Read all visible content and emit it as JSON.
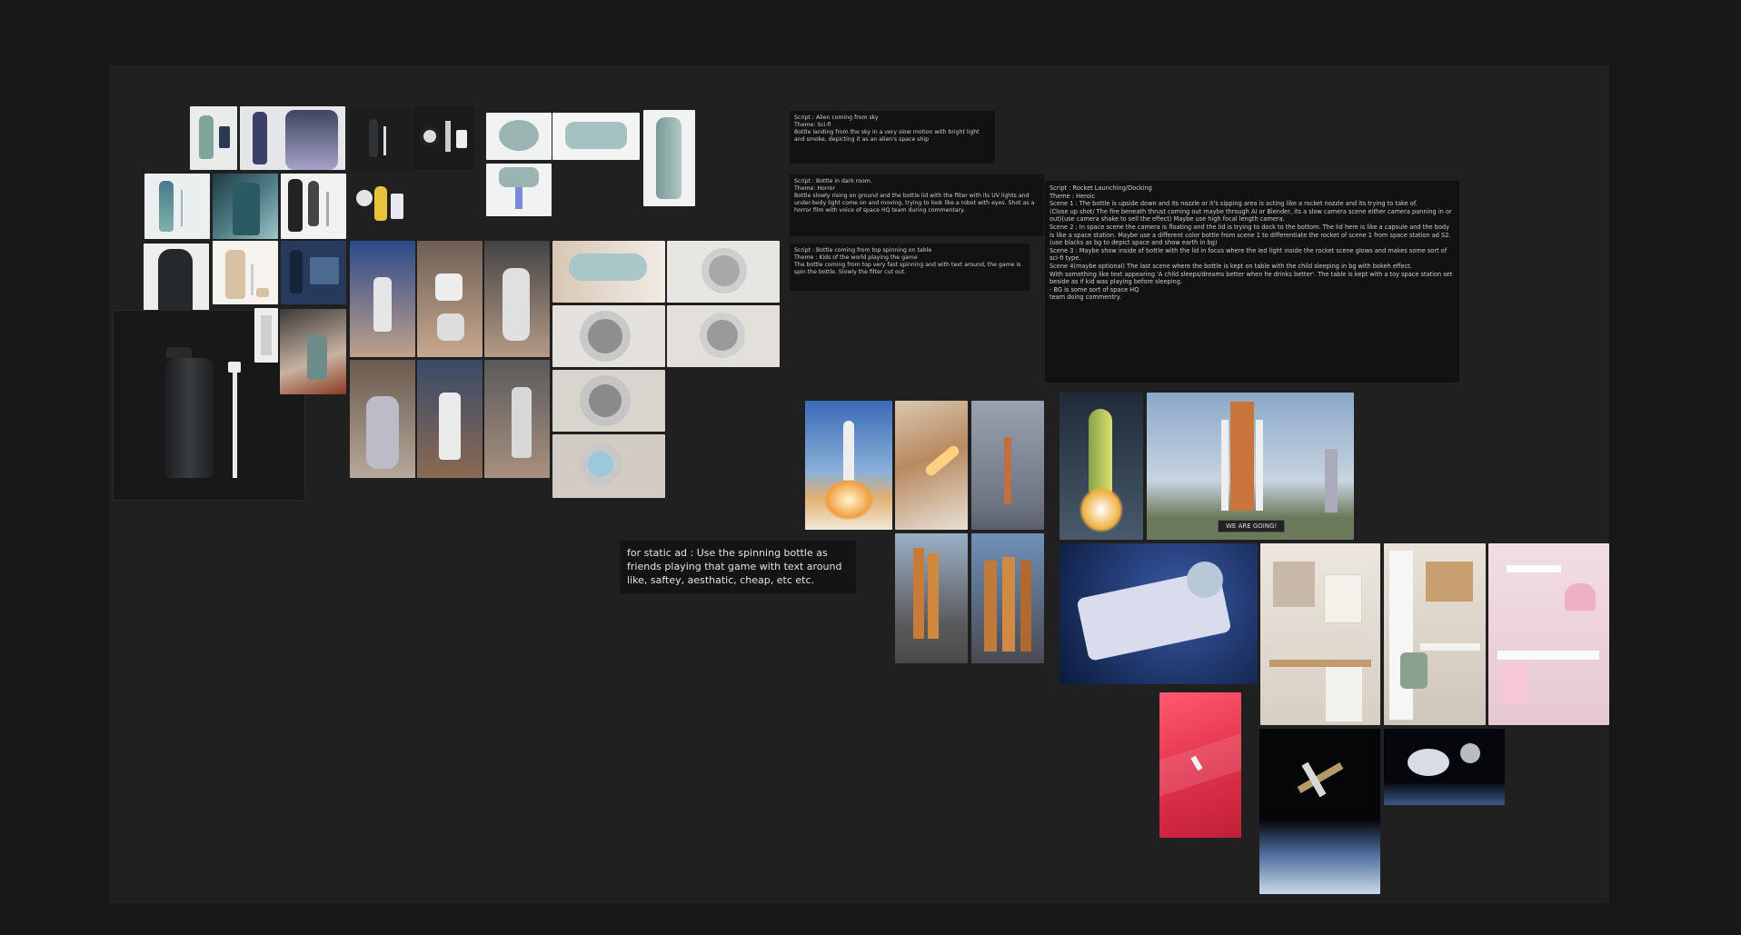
{
  "notes": {
    "n1": {
      "lines": [
        "Script : Alien coming from sky",
        "",
        "Theme: Sci-fi",
        "",
        "Bottle landing from the sky in a very slow motion with bright light and smoke, depicting it as an alien's space ship"
      ]
    },
    "n2": {
      "lines": [
        "Script : Bottle in dark room.",
        "",
        "Theme: Horror",
        "",
        "Bottle slowly rising on ground and the bottle lid with the filter with its UV lights and under-body light come on and moving, trying to look like a robot with eyes. Shot as a horror film with voice of space HQ team during commentary."
      ]
    },
    "n3": {
      "lines": [
        "Script : Bottle coming from top spinning on table",
        "Theme : Kids of the world playing the game",
        "",
        "The bottle coming from top very fast spinning and with text around, the game is spin the bottle. Slowly the filter cut out."
      ]
    },
    "n4": {
      "lines": [
        "Script : Rocket Launching/Docking",
        "",
        "Theme : Heroic",
        "",
        "Scene 1 : The bottle is upside down and its nozzle or it's sipping area is acting like a rocket nozzle and its trying to take of.",
        "(Close up shot/ The fire beneath thrust coming out maybe through AI or Blender, its a slow camera scene either camera panning in or out)(use camera shake to sell the effect) Maybe use high focal length camera.",
        "",
        "Scene 2 : In space scene the camera is floating and the lid is trying to dock to the bottom. The lid here is like a capsule and the body is like a space station. Maybe use a different color bottle from scene 1 to differentiate the rocket of scene 1 from space station ad S2. (use blacks as bg to depict space and show earth in bg)",
        "",
        "Scene 3 : Maybe show inside of bottle with the lid in focus where the led light inside the rocket scene glows and makes some sort of sci-fi type.",
        "",
        "Scene 4(maybe optional) The last scene where the bottle is kept on table with the child sleeping in bg with bokeh effect.",
        "With something like text appearing 'A child sleeps/dreams better when he drinks better'. The table is kept with a toy space station set beside as if kid was playing before sleeping.",
        "",
        "",
        "",
        "",
        "",
        "",
        "- BG is some sort of space HQ",
        "team doing commentry."
      ]
    },
    "static_ad": "for static ad : Use the spinning bottle as friends playing that game with text around like, saftey, aesthatic, cheap, etc etc."
  },
  "rocket_badge": "WE ARE GOING!",
  "colors": {
    "canvas": "#181818",
    "board": "#202020",
    "note_bg": "#121212",
    "note_text": "#cfcfcf"
  }
}
